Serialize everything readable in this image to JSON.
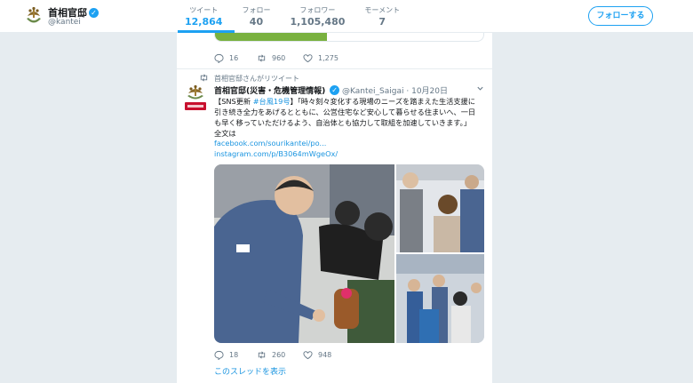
{
  "profile": {
    "name": "首相官邸",
    "handle": "@kantei",
    "verified_mark": "✓",
    "logo_icon": "paulownia-crest-icon"
  },
  "stats": [
    {
      "label": "ツイート",
      "value": "12,864",
      "active": true
    },
    {
      "label": "フォロー",
      "value": "40"
    },
    {
      "label": "フォロワー",
      "value": "1,105,480"
    },
    {
      "label": "モーメント",
      "value": "7"
    }
  ],
  "follow_button": "フォローする",
  "prev_tweet": {
    "actions": {
      "replies": "16",
      "retweets": "960",
      "likes": "1,275"
    }
  },
  "tweet": {
    "retweet_label": "首相官邸さんがリツイート",
    "author_name": "首相官邸(災害・危機管理情報)",
    "author_handle": "@Kantei_Saigai",
    "date": "10月20日",
    "lines": {
      "l1_pre": "【SNS更新 ",
      "l1_hash": "#台風19号",
      "l1_post": "】「時々刻々変化する現場のニーズを踏まえた生活支援に",
      "l2": "引き続き全力をあげるとともに、公営住宅など安心して暮らせる住まいへ、一日",
      "l3": "も早く移っていただけるよう、自治体とも協力して取組を加速していきます。」",
      "l4": "全文は"
    },
    "link1": "facebook.com/sourikantei/po...",
    "link2": "instagram.com/p/B3064mWgeOx/",
    "actions": {
      "replies": "18",
      "retweets": "260",
      "likes": "948"
    },
    "show_thread": "このスレッドを表示"
  },
  "colors": {
    "accent": "#1da1f2",
    "link": "#1b95e0",
    "muted": "#657786",
    "background": "#e6ecf0"
  }
}
